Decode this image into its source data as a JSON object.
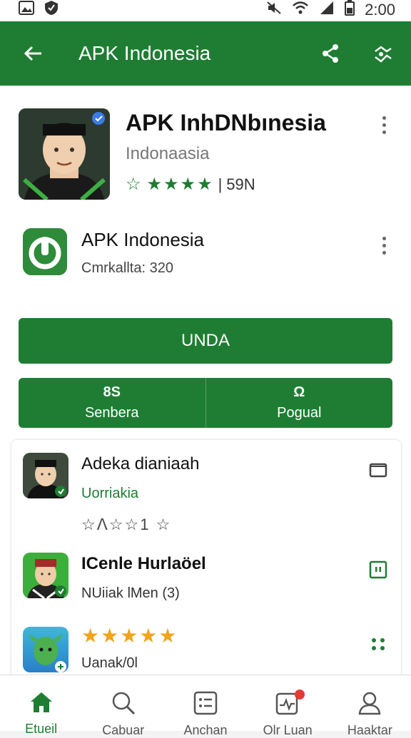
{
  "status_bar": {
    "time": "2:00",
    "icons": [
      "gallery-icon",
      "shield-icon",
      "mute-icon",
      "wifi-icon",
      "signal-icon",
      "battery-icon"
    ]
  },
  "app_bar": {
    "title": "APK Indonesia",
    "back_icon": "arrow-left-icon",
    "actions": [
      "share-icon",
      "route-icon"
    ]
  },
  "hero": {
    "name": "APK InhDNbınesia",
    "subtitle": "Indonaasia",
    "rating_value": "59N",
    "stars": "★★★★",
    "first_star": "☆"
  },
  "app2": {
    "name": "APK Indonesia",
    "subtitle": "Cmrkallta: 320"
  },
  "install_button": "UNDA",
  "segmented": [
    {
      "glyph": "8S",
      "label": "Senbera"
    },
    {
      "glyph": "Ω",
      "label": "Pogual"
    }
  ],
  "list_items": [
    {
      "title": "Adeka dianiaah",
      "subtitle": "Uorriakia",
      "rating": "☆ᐱ☆☆1 ☆",
      "action_icon": "folder-icon"
    },
    {
      "title": "ICenle Hurlaöel",
      "subtitle": "NUiiak lMen (3)",
      "action_icon": "pause-square-icon"
    },
    {
      "rating_stars": "★★★★★",
      "subtitle": "Uanak/​0l",
      "action_icon": "dots-grid-icon"
    }
  ],
  "bottom_nav": [
    {
      "label": "Etueil",
      "icon": "home-icon",
      "active": true
    },
    {
      "label": "Cabuar",
      "icon": "search-icon",
      "active": false
    },
    {
      "label": "Anchan",
      "icon": "list-icon",
      "active": false
    },
    {
      "label": "Olr Luan",
      "icon": "activity-icon",
      "active": false
    },
    {
      "label": "Haaktar",
      "icon": "person-icon",
      "active": false
    }
  ],
  "colors": {
    "primary": "#1e7d32",
    "star_orange": "#f2a41a"
  }
}
